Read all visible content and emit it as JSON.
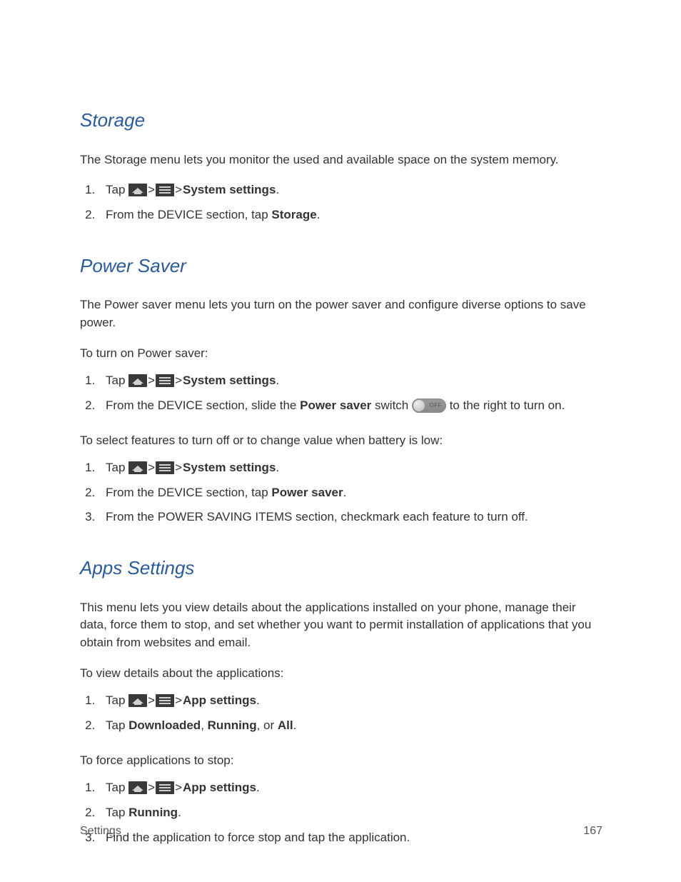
{
  "sections": {
    "storage": {
      "heading": "Storage",
      "intro": "The Storage menu lets you monitor the used and available space on the system memory.",
      "step1_pre": "Tap ",
      "step1_gt": " > ",
      "step1_bold": "System settings",
      "step1_post": ".",
      "step2_pre": "From the DEVICE section, tap ",
      "step2_bold": "Storage",
      "step2_post": "."
    },
    "powersaver": {
      "heading": "Power Saver",
      "intro": "The Power saver menu lets you turn on the power saver and configure diverse options to save power.",
      "sub1": "To turn on Power saver:",
      "a_step1_pre": "Tap ",
      "gt": " > ",
      "a_step1_bold": "System settings",
      "a_step1_post": ".",
      "a_step2_pre": "From the DEVICE section, slide the ",
      "a_step2_bold": "Power saver",
      "a_step2_mid": " switch ",
      "toggle_label": "OFF",
      "a_step2_post": " to the right to turn on.",
      "sub2": "To select features to turn off or to change value when battery is low:",
      "b_step1_pre": "Tap ",
      "b_step1_bold": "System settings",
      "b_step1_post": ".",
      "b_step2_pre": "From the DEVICE section, tap ",
      "b_step2_bold": "Power saver",
      "b_step2_post": ".",
      "b_step3": "From the POWER SAVING ITEMS section, checkmark each feature to turn off."
    },
    "apps": {
      "heading": "Apps Settings",
      "intro": "This menu lets you view details about the applications installed on your phone, manage their data, force them to stop, and set whether you want to permit installation of applications that you obtain from websites and email.",
      "sub1": "To view details about the applications:",
      "a_step1_pre": "Tap ",
      "gt": " > ",
      "a_step1_bold": "App settings",
      "a_step1_post": ".",
      "a_step2_pre": "Tap ",
      "a_step2_b1": "Downloaded",
      "a_step2_c1": ", ",
      "a_step2_b2": "Running",
      "a_step2_c2": ", or ",
      "a_step2_b3": "All",
      "a_step2_post": ".",
      "sub2": "To force applications to stop:",
      "b_step1_pre": "Tap ",
      "b_step1_bold": "App settings",
      "b_step1_post": ".",
      "b_step2_pre": "Tap ",
      "b_step2_bold": "Running",
      "b_step2_post": ".",
      "b_step3": "Find the application to force stop and tap the application."
    }
  },
  "footer": {
    "title": "Settings",
    "page": "167"
  }
}
